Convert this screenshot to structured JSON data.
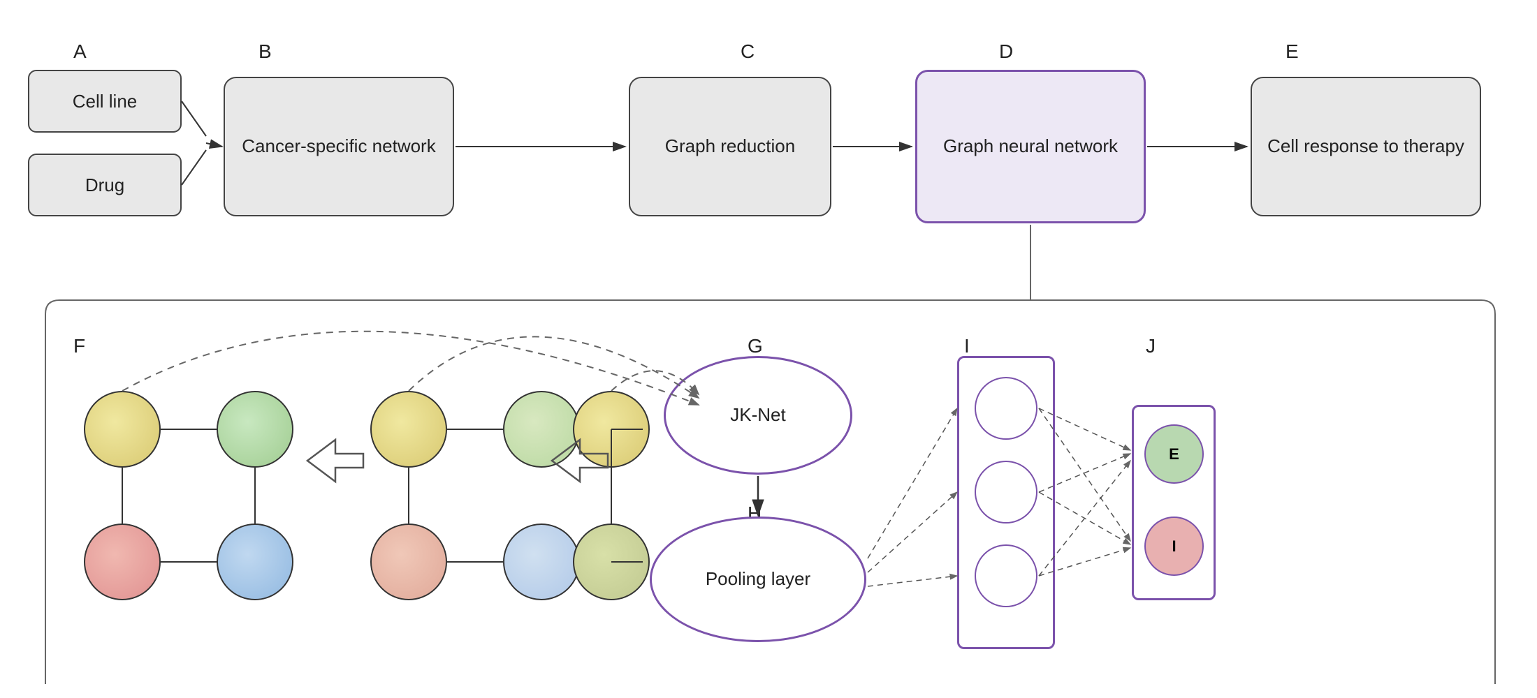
{
  "labels": {
    "A": "A",
    "B": "B",
    "C": "C",
    "D": "D",
    "E": "E",
    "F": "F",
    "G": "G",
    "H": "H",
    "I": "I",
    "J": "J"
  },
  "boxes": {
    "cell_line": "Cell line",
    "drug": "Drug",
    "cancer_network": "Cancer-specific network",
    "graph_reduction": "Graph reduction",
    "gnn": "Graph neural network",
    "cell_response": "Cell response to therapy",
    "jk_net": "JK-Net",
    "pooling": "Pooling layer"
  },
  "output_nodes": {
    "E": "E",
    "I": "I"
  },
  "colors": {
    "purple": "#7b52ab",
    "node_yellow": "#e8d89a",
    "node_green": "#b8d8b0",
    "node_pink": "#e8a8a8",
    "node_blue": "#b0cce8",
    "node_yellowgreen": "#d0e0a0",
    "node_out_E": "#b8d8b0",
    "node_out_I": "#e8b0b0"
  }
}
